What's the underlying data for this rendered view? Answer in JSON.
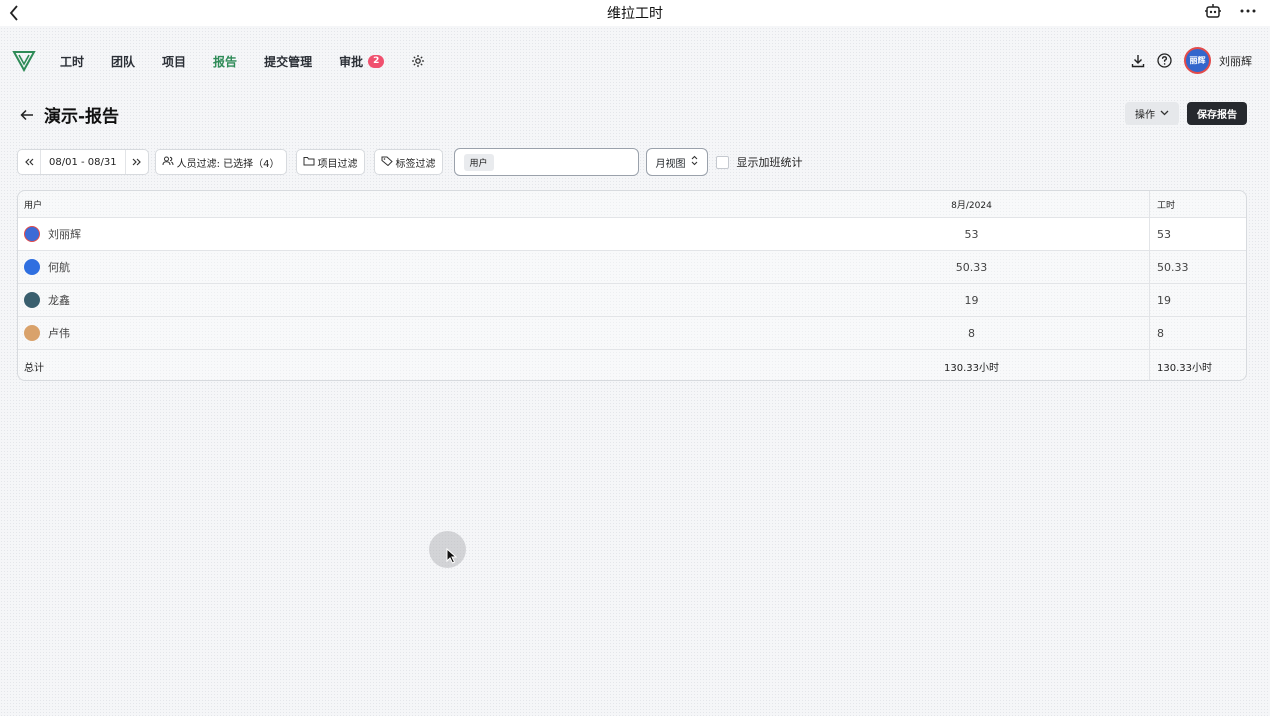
{
  "app": {
    "title": "维拉工时"
  },
  "nav": {
    "items": [
      {
        "label": "工时"
      },
      {
        "label": "团队"
      },
      {
        "label": "项目"
      },
      {
        "label": "报告",
        "active": true
      },
      {
        "label": "提交管理"
      },
      {
        "label": "审批",
        "badge": "2"
      }
    ],
    "user_name": "刘丽辉",
    "avatar_text": "丽辉"
  },
  "page": {
    "title": "演示-报告",
    "ops_label": "操作",
    "save_label": "保存报告"
  },
  "filters": {
    "date_range": "08/01 - 08/31",
    "people_filter": "人员过滤: 已选择（4）",
    "project_filter": "项目过滤",
    "tag_filter": "标签过滤",
    "group_tag": "用户",
    "view": "月视图",
    "overtime_label": "显示加班统计"
  },
  "table": {
    "headers": {
      "user": "用户",
      "month": "8月/2024",
      "hours": "工时"
    },
    "rows": [
      {
        "name": "刘丽辉",
        "month": "53",
        "hours": "53",
        "avatar_color": "#3d6bd6"
      },
      {
        "name": "何航",
        "month": "50.33",
        "hours": "50.33",
        "avatar_color": "#2f6fe0"
      },
      {
        "name": "龙鑫",
        "month": "19",
        "hours": "19",
        "avatar_color": "#3a5f6e"
      },
      {
        "name": "卢伟",
        "month": "8",
        "hours": "8",
        "avatar_color": "#d9a26b"
      }
    ],
    "total": {
      "label": "总计",
      "month": "130.33小时",
      "hours": "130.33小时"
    }
  },
  "colors": {
    "accent": "#2e8b57",
    "badge": "#f0506e",
    "save_button": "#26292e"
  }
}
